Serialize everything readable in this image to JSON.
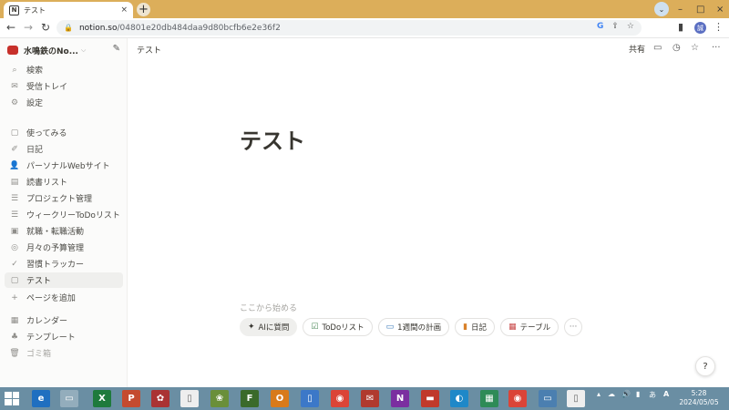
{
  "browser": {
    "tab": {
      "favicon": "N",
      "title": "テスト",
      "close": "×"
    },
    "new_tab": "+",
    "window_controls": {
      "down": "⌄",
      "min": "–",
      "max": "□",
      "close": "×"
    },
    "nav": {
      "back": "←",
      "forward": "→",
      "reload": "↻"
    },
    "url": {
      "host": "notion.so",
      "path": "/04801e20db484daa9d80bcfb6e2e36f2"
    },
    "omnibox_icons": {
      "google": "G",
      "share": "⇪",
      "star": "☆"
    },
    "avatar": "誠",
    "menu": "⋮"
  },
  "sidebar": {
    "workspace": "水鳴鉄のNo...",
    "workspace_chevron": "⌵",
    "compose": "✎",
    "top_items": [
      {
        "label": "検索",
        "icon": "⌕"
      },
      {
        "label": "受信トレイ",
        "icon": "✉"
      },
      {
        "label": "設定",
        "icon": "⚙"
      }
    ],
    "pages": [
      {
        "label": "使ってみる",
        "icon": "▢"
      },
      {
        "label": "日記",
        "icon": "✐"
      },
      {
        "label": "パーソナルWebサイト",
        "icon": "👤"
      },
      {
        "label": "読書リスト",
        "icon": "▤"
      },
      {
        "label": "プロジェクト管理",
        "icon": "☰"
      },
      {
        "label": "ウィークリーToDoリスト",
        "icon": "☰"
      },
      {
        "label": "就職・転職活動",
        "icon": "▣"
      },
      {
        "label": "月々の予算管理",
        "icon": "◎"
      },
      {
        "label": "習慣トラッカー",
        "icon": "✓"
      },
      {
        "label": "テスト",
        "icon": "▢"
      },
      {
        "label": "ページを追加",
        "icon": "+"
      }
    ],
    "bottom_items": [
      {
        "label": "カレンダー",
        "icon": "▦"
      },
      {
        "label": "テンプレート",
        "icon": "♣"
      },
      {
        "label": "ゴミ箱",
        "icon": "🗑"
      }
    ]
  },
  "page": {
    "breadcrumb": "テスト",
    "share": "共有",
    "title": "テスト",
    "start_hint": "ここから始める",
    "chips": [
      {
        "label": "AIに質問",
        "icon": "✦"
      },
      {
        "label": "ToDoリスト",
        "icon": "☑"
      },
      {
        "label": "1週間の計画",
        "icon": "▭"
      },
      {
        "label": "日記",
        "icon": "▮"
      },
      {
        "label": "テーブル",
        "icon": "▦"
      }
    ],
    "chip_more": "···",
    "help": "?"
  },
  "taskbar": {
    "time": "5:28",
    "date": "2024/05/05",
    "ime": "あ",
    "apps": [
      "e",
      "▭",
      "X",
      "P",
      "✿",
      "▯",
      "❀",
      "F",
      "O",
      "▯",
      "◉",
      "✉",
      "N",
      "▬",
      "◐",
      "▦",
      "◉",
      "▭",
      "▯"
    ]
  },
  "colors": {
    "taskbar": "#6a8ea3",
    "tabstrip": "#dcae5a",
    "brand": "#c7302a"
  }
}
